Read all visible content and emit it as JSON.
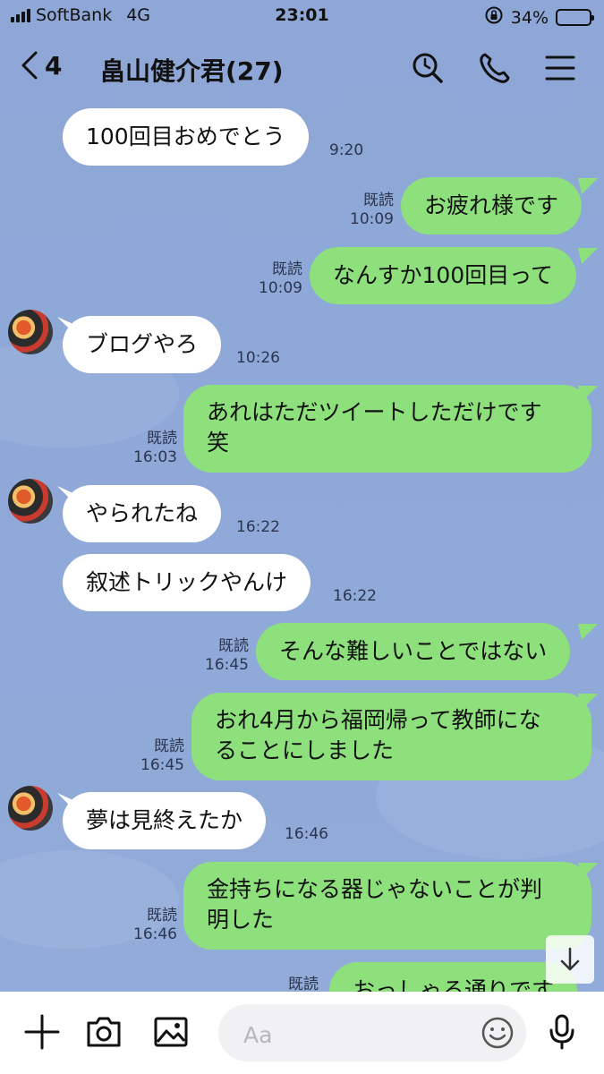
{
  "status_bar": {
    "carrier": "SoftBank",
    "network": "4G",
    "time": "23:01",
    "battery": "34%",
    "battery_level": 0.34
  },
  "header": {
    "back_count": "4",
    "title": "畠山健介君(27)"
  },
  "messages": [
    {
      "dir": "in",
      "text": "100回目おめでとう",
      "time": "9:20",
      "read": "",
      "avatar": false
    },
    {
      "dir": "out",
      "text": "お疲れ様です",
      "time": "10:09",
      "read": "既読"
    },
    {
      "dir": "out",
      "text": "なんすか100回目って",
      "time": "10:09",
      "read": "既読"
    },
    {
      "dir": "in",
      "text": "ブログやろ",
      "time": "10:26",
      "read": "",
      "avatar": true
    },
    {
      "dir": "out",
      "text_lines": [
        "あれはただツイートしただけです",
        "笑"
      ],
      "time": "16:03",
      "read": "既読"
    },
    {
      "dir": "in",
      "text": "やられたね",
      "time": "16:22",
      "read": "",
      "avatar": true
    },
    {
      "dir": "in",
      "text": "叙述トリックやんけ",
      "time": "16:22",
      "read": "",
      "avatar": false
    },
    {
      "dir": "out",
      "text": "そんな難しいことではない",
      "time": "16:45",
      "read": "既読"
    },
    {
      "dir": "out",
      "text_lines": [
        "おれ4月から福岡帰って教師にな",
        "ることにしました"
      ],
      "time": "16:45",
      "read": "既読"
    },
    {
      "dir": "in",
      "text": "夢は見終えたか",
      "time": "16:46",
      "read": "",
      "avatar": true
    },
    {
      "dir": "out",
      "text_lines": [
        "金持ちになる器じゃないことが判",
        "明した"
      ],
      "time": "16:46",
      "read": "既読"
    },
    {
      "dir": "out",
      "text": "おっしゃる通りです",
      "time": "",
      "read": "既読"
    }
  ],
  "input": {
    "placeholder": "Aa"
  },
  "icons": {
    "search": "search-icon",
    "call": "phone-icon",
    "menu": "menu-icon",
    "plus": "plus-icon",
    "camera": "camera-icon",
    "image": "image-icon",
    "emoji": "emoji-icon",
    "mic": "mic-icon",
    "scroll": "arrow-down-icon"
  },
  "colors": {
    "background": "#8fa8d6",
    "out_bubble": "#8de07c",
    "in_bubble": "#ffffff"
  }
}
